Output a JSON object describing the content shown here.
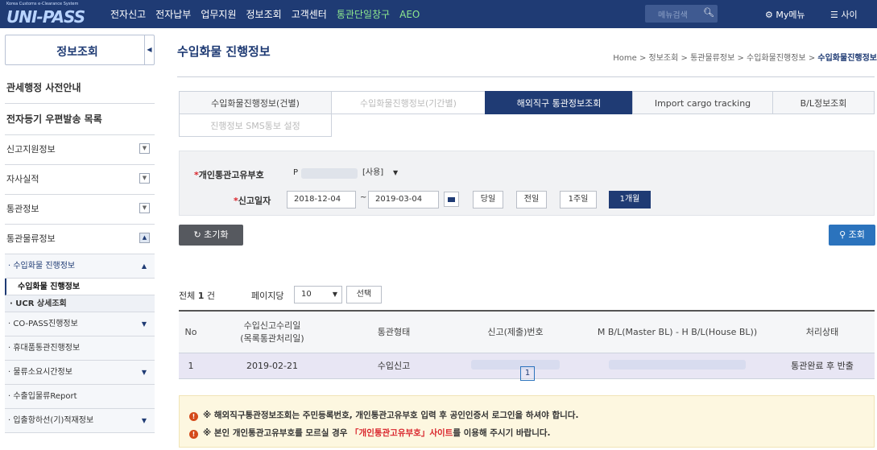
{
  "header": {
    "logo_small": "Korea Customs e-Clearance System",
    "logo": "UNI-PASS",
    "menus": [
      "전자신고",
      "전자납부",
      "업무지원",
      "정보조회",
      "고객센터",
      "통관단일창구",
      "AEO"
    ],
    "search_placeholder": "메뉴검색",
    "mymenu": "My메뉴",
    "sitemap": "사이"
  },
  "sidebar": {
    "title": "정보조회",
    "items": [
      {
        "label": "관세행정 사전안내"
      },
      {
        "label": "전자등기 우편발송 목록"
      },
      {
        "label": "신고지원정보"
      },
      {
        "label": "자사실적"
      },
      {
        "label": "통관정보"
      },
      {
        "label": "통관물류정보"
      },
      {
        "label": "· 수입화물 진행정보"
      },
      {
        "label": "수입화물 진행정보"
      },
      {
        "label": "· UCR 상세조회"
      },
      {
        "label": "· CO-PASS진행정보"
      },
      {
        "label": "· 휴대품통관진행정보"
      },
      {
        "label": "· 물류소요시간정보"
      },
      {
        "label": "· 수출입물류Report"
      },
      {
        "label": "· 입출항하선(기)적재정보"
      }
    ]
  },
  "page": {
    "title": "수입화물 진행정보",
    "breadcrumb": [
      "Home",
      "정보조회",
      "통관물류정보",
      "수입화물진행정보",
      "수입화물진행정보"
    ]
  },
  "tabs": [
    "수입화물진행정보(건별)",
    "수입화물진행정보(기간별)",
    "해외직구 통관정보조회",
    "Import cargo tracking",
    "B/L정보조회",
    "진행정보 SMS통보 설정"
  ],
  "form": {
    "pccc_label": "개인통관고유부호",
    "pccc_value": "P",
    "pccc_status": "[사용]",
    "date_label": "신고일자",
    "date_from": "2018-12-04",
    "date_sep": "~",
    "date_to": "2019-03-04",
    "period_buttons": [
      "당일",
      "전일",
      "1주일",
      "1개월"
    ],
    "reset": "초기화",
    "query": "조회"
  },
  "list": {
    "total_prefix": "전체",
    "total_count": "1",
    "total_suffix": "건",
    "per_page_label": "페이지당",
    "per_page": "10",
    "select_btn": "선택",
    "columns": [
      "No",
      "수입신고수리일",
      "(목록통관처리일)",
      "통관형태",
      "신고(제출)번호",
      "M B/L(Master BL) - H B/L(House BL))",
      "처리상태"
    ],
    "rows": [
      {
        "no": "1",
        "date": "2019-02-21",
        "type": "수입신고",
        "status": "통관완료 후 반출"
      }
    ],
    "page": "1"
  },
  "notice": {
    "line1": "※ 해외직구통관정보조회는 주민등록번호, 개인통관고유부호 입력 후 공인인증서 로그인을 하셔야 합니다.",
    "line2_a": "※ 본인 개인통관고유부호를 모르실 경우 ",
    "line2_link": "「개인통관고유부호」사이트",
    "line2_b": "를 이용해 주시기 바랍니다."
  }
}
